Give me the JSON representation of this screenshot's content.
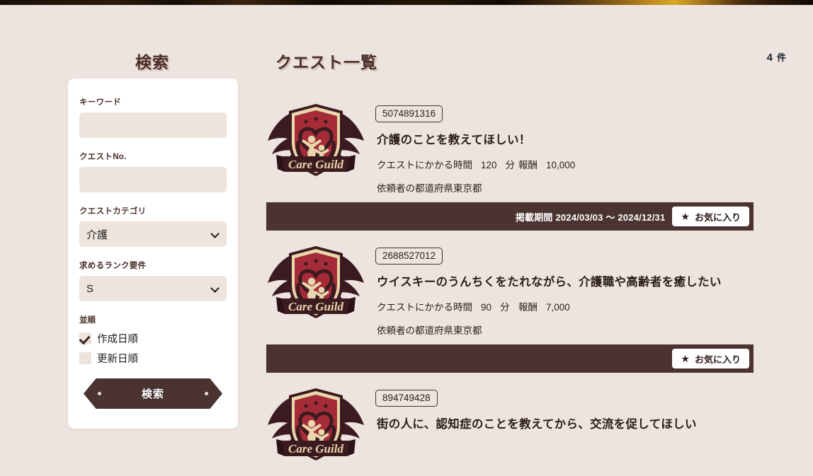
{
  "header_strip": {
    "name": "decorative-banner-strip"
  },
  "search": {
    "title": "検索",
    "keyword": {
      "label": "キーワード",
      "value": "",
      "placeholder": ""
    },
    "quest_no": {
      "label": "クエストNo.",
      "value": "",
      "placeholder": ""
    },
    "category": {
      "label": "クエストカテゴリ",
      "value": "介護"
    },
    "rank": {
      "label": "求めるランク要件",
      "value": "S"
    },
    "sort": {
      "label": "並順",
      "options": [
        {
          "label": "作成日順",
          "checked": true
        },
        {
          "label": "更新日順",
          "checked": false
        }
      ]
    },
    "submit_label": "検索"
  },
  "list": {
    "title": "クエスト一覧",
    "count": "4",
    "count_unit": "件",
    "labels": {
      "duration": "クエストにかかる時間",
      "duration_unit": "分",
      "reward": "報酬",
      "prefecture": "依頼者の都道府県",
      "period": "掲載期間",
      "period_sep": "〜",
      "favorite": "お気に入り"
    },
    "emblem_text": "Care Guild",
    "quests": [
      {
        "no": "5074891316",
        "title": "介護のことを教えてほしい！",
        "duration": "120",
        "reward": "10,000",
        "prefecture": "東京都",
        "period_start": "2024/03/03",
        "period_end": "2024/12/31",
        "has_period": true
      },
      {
        "no": "2688527012",
        "title": "ウイスキーのうんちくをたれながら、介護職や高齢者を癒したい",
        "duration": "90",
        "reward": "7,000",
        "prefecture": "東京都",
        "period_start": "",
        "period_end": "",
        "has_period": false
      },
      {
        "no": "894749428",
        "title": "街の人に、認知症のことを教えてから、交流を促してほしい",
        "duration": "",
        "reward": "",
        "prefecture": "",
        "period_start": "",
        "period_end": "",
        "has_period": false
      }
    ]
  },
  "colors": {
    "background": "#EEE4DF",
    "dark_brown": "#4A3330",
    "heading": "#4A2F2C",
    "field_bg": "#EDE4DE",
    "panel": "#FFFFFF",
    "emblem_red": "#A62B38",
    "emblem_cream": "#E8D7AC",
    "emblem_dark": "#3B1B20"
  }
}
